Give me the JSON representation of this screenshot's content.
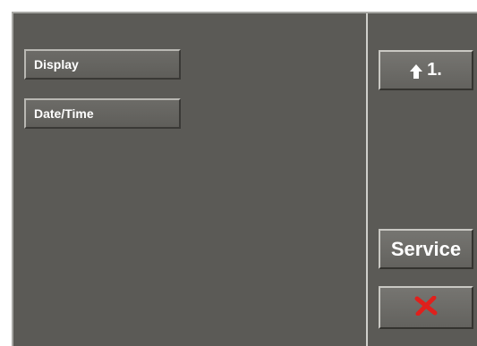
{
  "menu": {
    "items": [
      {
        "label": "Display"
      },
      {
        "label": "Date/Time"
      }
    ]
  },
  "side_buttons": {
    "up": {
      "label": "1.",
      "icon": "up-arrow-icon"
    },
    "service": {
      "label": "Service"
    },
    "close": {
      "icon": "close-x-icon",
      "color": "#e0201c"
    }
  },
  "colors": {
    "background": "#5b5a56",
    "button": "#6c6b67",
    "text": "#ffffff",
    "close_accent": "#e0201c"
  }
}
